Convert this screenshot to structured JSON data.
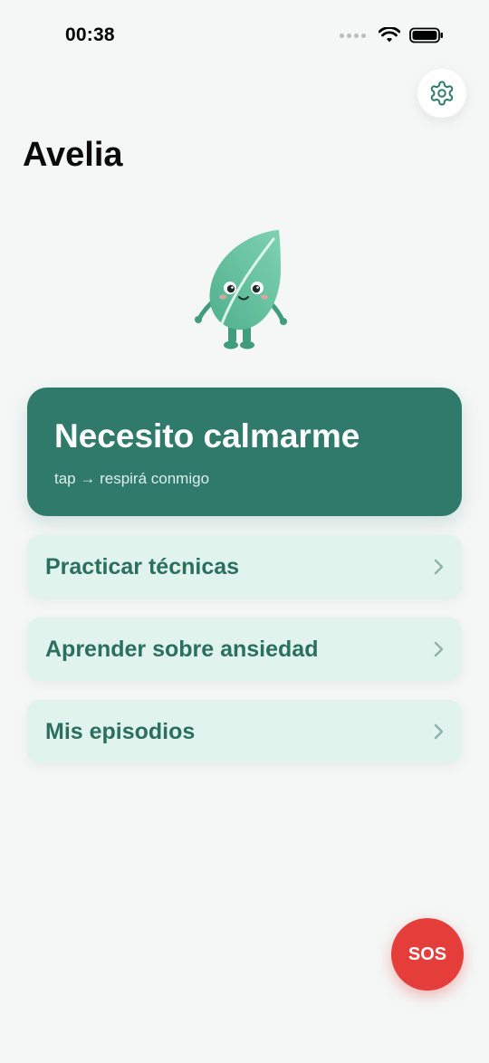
{
  "status_bar": {
    "time": "00:38"
  },
  "header": {
    "title": "Avelia"
  },
  "calm_card": {
    "title": "Necesito calmarme",
    "subtitle": "tap → respirá conmigo"
  },
  "menu": {
    "items": [
      {
        "label": "Practicar técnicas"
      },
      {
        "label": "Aprender sobre ansiedad"
      },
      {
        "label": "Mis episodios"
      }
    ]
  },
  "sos": {
    "label": "SOS"
  },
  "colors": {
    "primary": "#2f7a6b",
    "menu_bg": "#e0f3ec",
    "menu_text": "#2a6f60",
    "sos": "#e53e3a",
    "background": "#f4f7f6"
  },
  "icons": [
    "settings-gear",
    "chevron-right",
    "wifi",
    "battery",
    "leaf-mascot"
  ]
}
